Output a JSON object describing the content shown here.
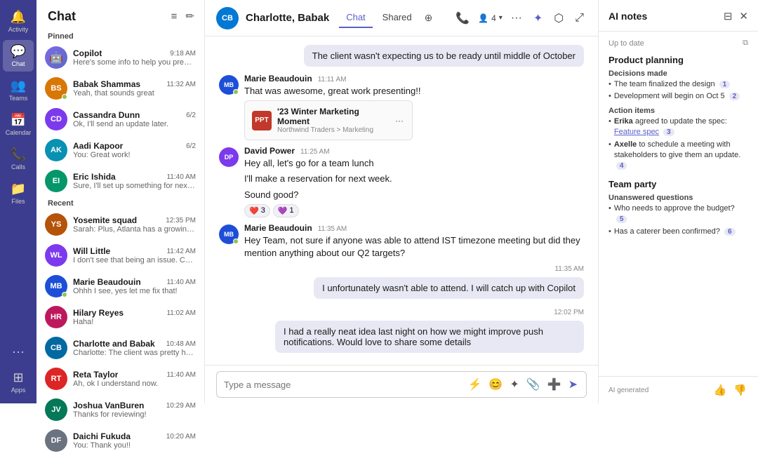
{
  "nav": {
    "items": [
      {
        "id": "activity",
        "label": "Activity",
        "icon": "🔔",
        "active": false
      },
      {
        "id": "chat",
        "label": "Chat",
        "icon": "💬",
        "active": true
      },
      {
        "id": "teams",
        "label": "Teams",
        "icon": "👥",
        "active": false
      },
      {
        "id": "calendar",
        "label": "Calendar",
        "icon": "📅",
        "active": false
      },
      {
        "id": "calls",
        "label": "Calls",
        "icon": "📞",
        "active": false
      },
      {
        "id": "files",
        "label": "Files",
        "icon": "📁",
        "active": false
      },
      {
        "id": "more",
        "label": "···",
        "icon": "···",
        "active": false
      },
      {
        "id": "apps",
        "label": "Apps",
        "icon": "⊞",
        "active": false
      }
    ]
  },
  "chatList": {
    "title": "Chat",
    "pinnedLabel": "Pinned",
    "recentLabel": "Recent",
    "pinned": [
      {
        "id": "copilot",
        "name": "Copilot",
        "time": "9:18 AM",
        "preview": "Here's some info to help you prep for your...",
        "avatarText": "🤖",
        "avatarColor": "#5c6bc0",
        "status": "green"
      },
      {
        "id": "babak",
        "name": "Babak Shammas",
        "time": "11:32 AM",
        "preview": "Yeah, that sounds great",
        "avatarText": "BS",
        "avatarColor": "#d97706",
        "status": "green"
      },
      {
        "id": "cassandra",
        "name": "Cassandra Dunn",
        "time": "6/2",
        "preview": "Ok, I'll send an update later.",
        "avatarText": "CD",
        "avatarColor": "#7c3aed",
        "status": null
      },
      {
        "id": "aadi",
        "name": "Aadi Kapoor",
        "time": "6/2",
        "preview": "You: Great work!",
        "avatarText": "AK",
        "avatarColor": "#0891b2",
        "status": null
      },
      {
        "id": "eric",
        "name": "Eric Ishida",
        "time": "11:40 AM",
        "preview": "Sure, I'll set up something for next week t...",
        "avatarText": "EI",
        "avatarColor": "#059669",
        "status": null
      }
    ],
    "recent": [
      {
        "id": "yosemite",
        "name": "Yosemite squad",
        "time": "12:35 PM",
        "preview": "Sarah: Plus, Atlanta has a growing tech ...",
        "avatarText": "YS",
        "avatarColor": "#b45309",
        "status": null
      },
      {
        "id": "will",
        "name": "Will Little",
        "time": "11:42 AM",
        "preview": "I don't see that being an issue. Can you ta...",
        "avatarText": "WL",
        "avatarColor": "#7c3aed",
        "status": null
      },
      {
        "id": "marie",
        "name": "Marie Beaudouin",
        "time": "11:40 AM",
        "preview": "Ohhh I see, yes let me fix that!",
        "avatarText": "MB",
        "avatarColor": "#1d4ed8",
        "status": "green"
      },
      {
        "id": "hilary",
        "name": "Hilary Reyes",
        "time": "11:02 AM",
        "preview": "Haha!",
        "avatarText": "HR",
        "avatarColor": "#be185d",
        "status": null
      },
      {
        "id": "charlotte",
        "name": "Charlotte and Babak",
        "time": "10:48 AM",
        "preview": "Charlotte: The client was pretty happy with...",
        "avatarText": "CB",
        "avatarColor": "#0369a1",
        "status": null
      },
      {
        "id": "reta",
        "name": "Reta Taylor",
        "time": "11:40 AM",
        "preview": "Ah, ok I understand now.",
        "avatarText": "RT",
        "avatarColor": "#dc2626",
        "status": null
      },
      {
        "id": "joshua",
        "name": "Joshua VanBuren",
        "time": "10:29 AM",
        "preview": "Thanks for reviewing!",
        "avatarText": "JV",
        "avatarColor": "#047857",
        "status": null
      },
      {
        "id": "daichi",
        "name": "Daichi Fukuda",
        "time": "10:20 AM",
        "preview": "You: Thank you!!",
        "avatarText": "DF",
        "avatarColor": "#6b7280",
        "status": null
      }
    ]
  },
  "chatMain": {
    "headerName": "Charlotte, Babak",
    "headerAvatarText": "CB",
    "tabChat": "Chat",
    "tabShared": "Shared",
    "participantsCount": "4",
    "messages": [
      {
        "id": "m0",
        "type": "self-bubble",
        "text": "The client wasn't expecting us to be ready until middle of October"
      },
      {
        "id": "m1",
        "type": "incoming",
        "sender": "Marie Beaudouin",
        "time": "11:11 AM",
        "avatarText": "MB",
        "avatarColor": "#1d4ed8",
        "statusDot": true,
        "text": "That was awesome, great work presenting!!",
        "hasAttachment": true,
        "attachmentName": "'23 Winter Marketing Moment",
        "attachmentPath": "Northwind Traders > Marketing"
      },
      {
        "id": "m2",
        "type": "incoming",
        "sender": "David Power",
        "time": "11:25 AM",
        "avatarText": "DP",
        "avatarColor": "#7c3aed",
        "statusDot": false,
        "lines": [
          "Hey all, let's go for a team lunch",
          "I'll make a reservation for next week.",
          "Sound good?"
        ],
        "reactions": [
          {
            "emoji": "❤️",
            "count": "3"
          },
          {
            "emoji": "💜",
            "count": "1"
          }
        ]
      },
      {
        "id": "m3",
        "type": "incoming",
        "sender": "Marie Beaudouin",
        "time": "11:35 AM",
        "avatarText": "MB",
        "avatarColor": "#1d4ed8",
        "statusDot": true,
        "text": "Hey Team, not sure if anyone was able to attend IST timezone meeting but did they mention anything about our Q2 targets?"
      },
      {
        "id": "m4",
        "type": "self-bubble",
        "timeAbove": "11:35 AM",
        "text": "I unfortunately wasn't able to attend. I will catch up with Copilot"
      },
      {
        "id": "m5",
        "type": "self-bubble",
        "timeAbove": "12:02 PM",
        "text": "I had a really neat idea last night on how we might improve push notifications. Would love to share some details"
      }
    ],
    "inputPlaceholder": "Type a message"
  },
  "aiNotes": {
    "title": "AI notes",
    "dateLabel": "Up to date",
    "sections": [
      {
        "title": "Product planning",
        "subsections": [
          {
            "label": "Decisions made",
            "items": [
              {
                "text": "The team finalized the design",
                "badge": "1"
              },
              {
                "text": "Development will begin on Oct 5",
                "badge": "2"
              }
            ]
          },
          {
            "label": "Action items",
            "items": [
              {
                "boldPart": "Erika",
                "text": " agreed to update the spec:",
                "link": "Feature spec",
                "badge": "3"
              },
              {
                "boldPart": "Axelle",
                "text": " to schedule a meeting with stakeholders to give them an update.",
                "badge": "4"
              }
            ]
          }
        ]
      },
      {
        "title": "Team party",
        "subsections": [
          {
            "label": "Unanswered questions",
            "items": [
              {
                "text": "Who needs to approve the budget?",
                "badge": "5"
              },
              {
                "text": "Has a caterer been confirmed?",
                "badge": "6"
              }
            ]
          }
        ]
      }
    ],
    "footerLabel": "AI generated"
  }
}
